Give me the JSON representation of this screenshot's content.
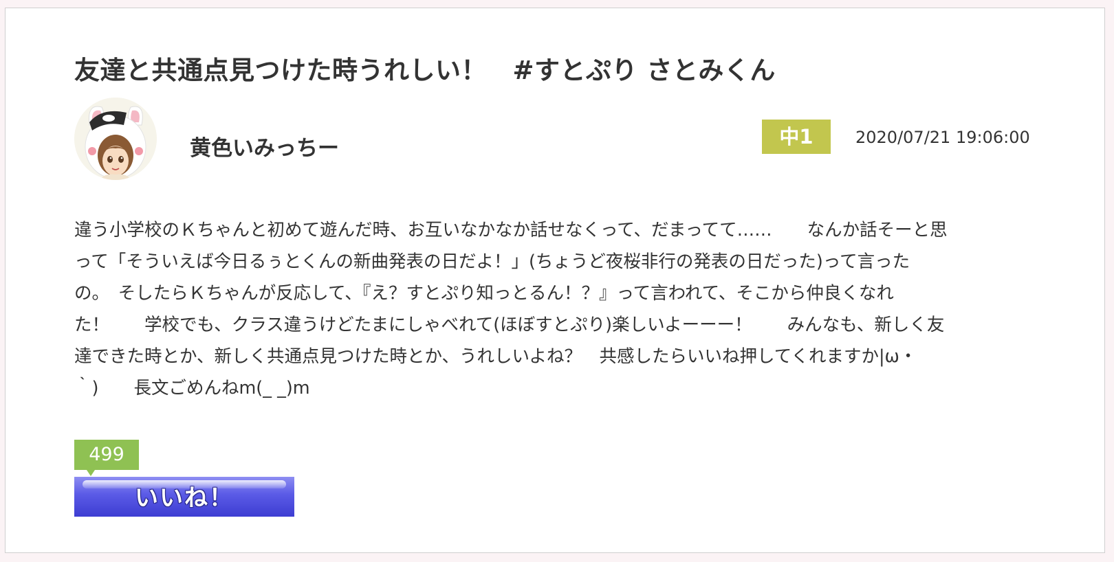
{
  "post": {
    "title": "友達と共通点見つけた時うれしい！　#すとぷり さとみくん",
    "author": {
      "name": "黄色いみっちー",
      "avatar_icon": "girl-avatar-with-bunny-hood-icon"
    },
    "grade_badge": "中1",
    "timestamp": "2020/07/21 19:06:00",
    "body_lines": [
      "違う小学校のＫちゃんと初めて遊んだ時、お互いなかなか話せなくって、だまってて……　　なんか話そーと思",
      "って「そういえば今日るぅとくんの新曲発表の日だよ！」(ちょうど夜桜非行の発表の日だった)って言った",
      "の。　そしたらＫちゃんが反応して、『え？すとぷり知っとるん！？』って言われて、そこから仲良くなれ",
      "た！　　学校でも、クラス違うけどたまにしゃべれて(ほぼすとぷり)楽しいよーーー！　　みんなも、新しく友",
      "達できた時とか、新しく共通点見つけた時とか、うれしいよね？　共感したらいいね押してくれますか|ω・",
      "｀)　　長文ごめんねm(_ _)m"
    ],
    "like": {
      "count": "499",
      "button_label": "いいね！"
    }
  },
  "colors": {
    "page_background": "#fbf3f5",
    "grade_badge": "#c2c64e",
    "like_count_bubble": "#8fc153",
    "like_button": "#5a5ae6"
  }
}
